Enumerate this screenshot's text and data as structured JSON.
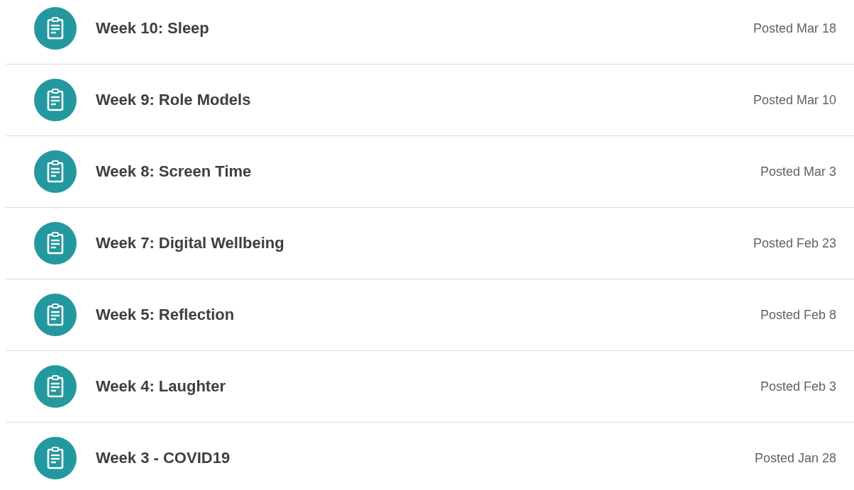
{
  "assignments": [
    {
      "title": "Week 10: Sleep",
      "posted": "Posted Mar 18"
    },
    {
      "title": "Week 9: Role Models",
      "posted": "Posted Mar 10"
    },
    {
      "title": "Week 8: Screen Time",
      "posted": "Posted Mar 3"
    },
    {
      "title": "Week 7: Digital Wellbeing",
      "posted": "Posted Feb 23"
    },
    {
      "title": "Week 5: Reflection",
      "posted": "Posted Feb 8"
    },
    {
      "title": "Week 4: Laughter",
      "posted": "Posted Feb 3"
    },
    {
      "title": "Week 3 - COVID19",
      "posted": "Posted Jan 28"
    }
  ]
}
